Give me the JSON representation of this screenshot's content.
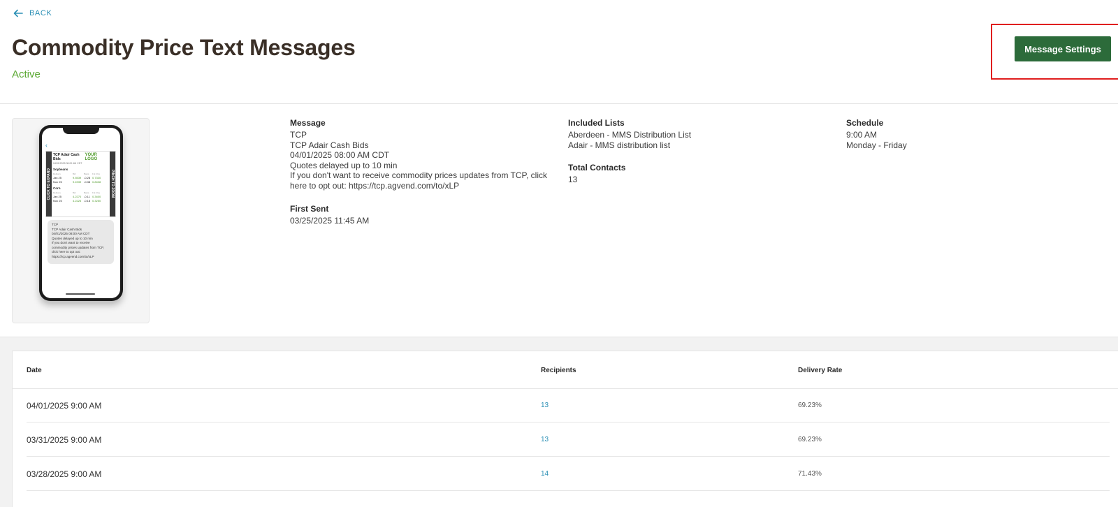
{
  "nav": {
    "back_label": "BACK"
  },
  "header": {
    "title": "Commodity Price Text Messages",
    "status": "Active",
    "settings_label": "Message Settings",
    "accent": "#2c6b3a",
    "status_color": "#5aa832",
    "highlight_color": "#e01e1e"
  },
  "preview": {
    "mms_title": "TCP Adair Cash Bids",
    "mms_logo": "YOUR LOGO",
    "mms_date": "04/01/2025 08:00 AM CDT",
    "left_tab": "CLICK TO EXPAND",
    "right_tab": "PINCH TO ZOOM",
    "groups": [
      {
        "name": "Soybeans",
        "header": [
          "Delivery",
          "Bid",
          "Basis",
          "Fut Chg"
        ],
        "rows": [
          [
            "Jan 25",
            "9.5539",
            "-0.28",
            "0.7330"
          ],
          [
            "Nov 25",
            "9.4939",
            "-0.38",
            "0.8408"
          ]
        ]
      },
      {
        "name": "Corn",
        "header": [
          "Delivery",
          "Bid",
          "Basis",
          "Fut Chg"
        ],
        "rows": [
          [
            "Jan 25",
            "4.2270",
            "-0.11",
            "0.3400"
          ],
          [
            "Nov 25",
            "4.2225",
            "-0.18",
            "0.3250"
          ]
        ]
      }
    ],
    "bubble_lines": [
      "TCP",
      "TCP Adair Cash Bids",
      "04/01/2025 08:00 AM CDT",
      "Quotes delayed up to 10 min",
      "If you don't want to receive",
      "commodity prices updates from TCP,",
      "click here to opt out:",
      "https://tcp.agvend.com/to/xLP"
    ]
  },
  "details": {
    "message_label": "Message",
    "message_lines": [
      "TCP",
      "TCP Adair Cash Bids",
      "04/01/2025 08:00 AM CDT",
      "Quotes delayed up to 10 min",
      "If you don't want to receive commodity prices updates from TCP, click",
      "here to opt out: https://tcp.agvend.com/to/xLP"
    ],
    "first_sent_label": "First Sent",
    "first_sent": "03/25/2025 11:45 AM",
    "lists_label": "Included Lists",
    "lists": [
      "Aberdeen - MMS Distribution List",
      "Adair - MMS distribution list"
    ],
    "contacts_label": "Total Contacts",
    "contacts": "13",
    "schedule_label": "Schedule",
    "schedule_time": "9:00 AM",
    "schedule_days": "Monday - Friday"
  },
  "history": {
    "columns": [
      "Date",
      "Recipients",
      "Delivery Rate"
    ],
    "rows": [
      {
        "date": "04/01/2025 9:00 AM",
        "recipients": "13",
        "rate": "69.23%"
      },
      {
        "date": "03/31/2025 9:00 AM",
        "recipients": "13",
        "rate": "69.23%"
      },
      {
        "date": "03/28/2025 9:00 AM",
        "recipients": "14",
        "rate": "71.43%"
      }
    ]
  }
}
